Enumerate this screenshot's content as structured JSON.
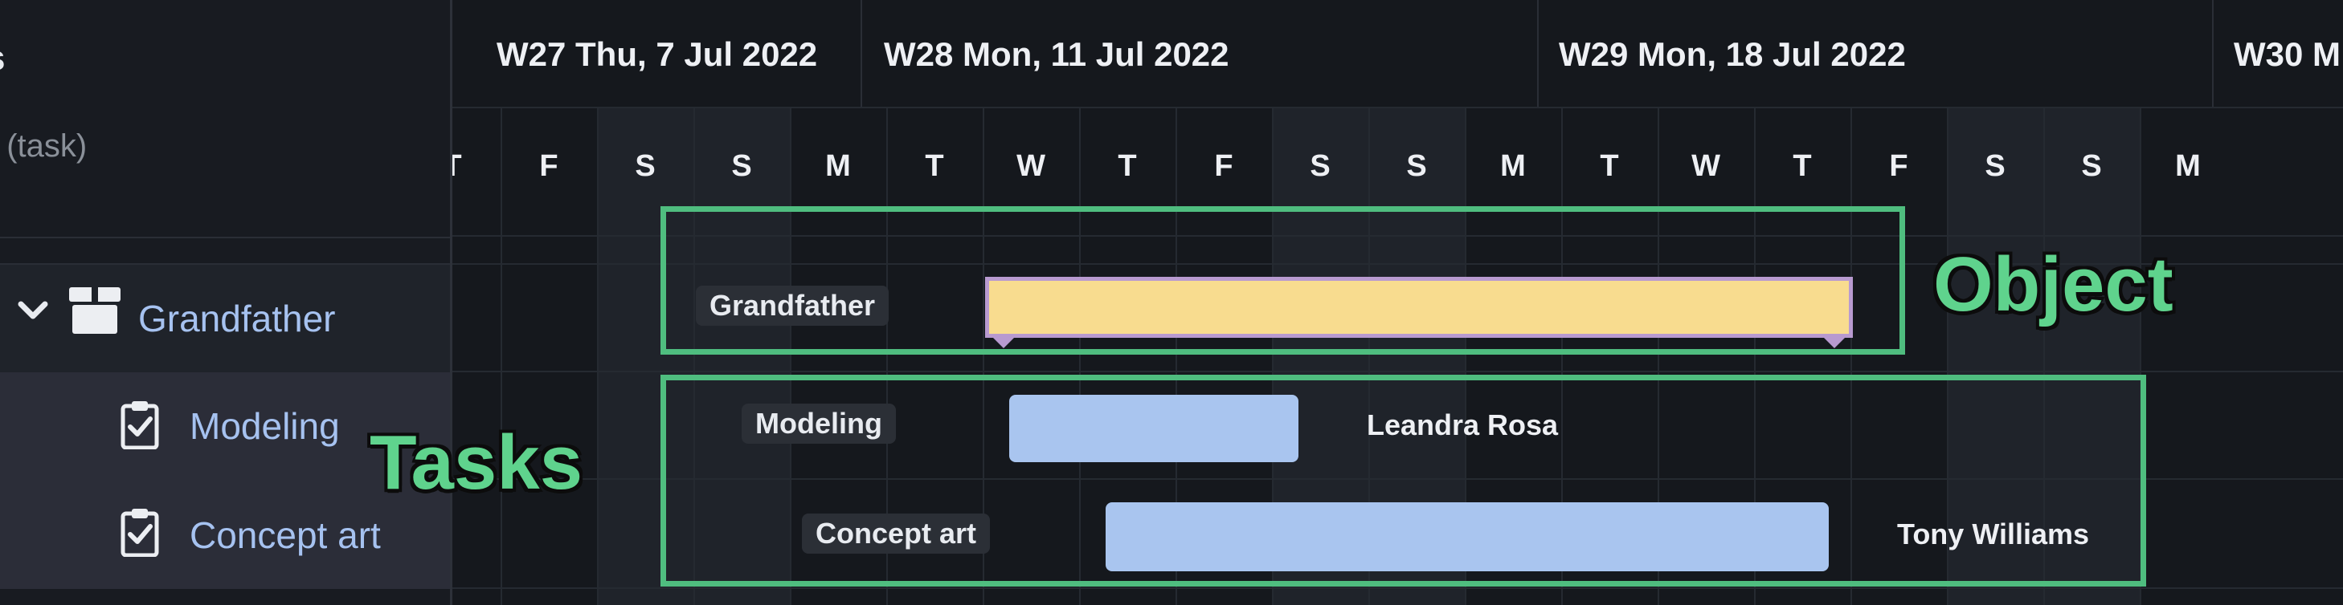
{
  "left_panel": {
    "header_title": "s",
    "header_subtitle": "t (task)",
    "rows": {
      "grandfather": {
        "label": "Grandfather",
        "icon": "box-icon",
        "expand_icon": "chevron-down-icon"
      },
      "modeling": {
        "label": "Modeling",
        "icon": "clipboard-check-icon"
      },
      "concept_art": {
        "label": "Concept art",
        "icon": "clipboard-check-icon"
      }
    }
  },
  "timeline": {
    "weeks": [
      {
        "label": "W27 Thu, 7 Jul 2022"
      },
      {
        "label": "W28 Mon, 11 Jul 2022"
      },
      {
        "label": "W29 Mon, 18 Jul 2022"
      },
      {
        "label": "W30 M"
      }
    ],
    "days": [
      {
        "letter": "T",
        "weekend": false
      },
      {
        "letter": "F",
        "weekend": false
      },
      {
        "letter": "S",
        "weekend": true
      },
      {
        "letter": "S",
        "weekend": true
      },
      {
        "letter": "M",
        "weekend": false
      },
      {
        "letter": "T",
        "weekend": false
      },
      {
        "letter": "W",
        "weekend": false
      },
      {
        "letter": "T",
        "weekend": false
      },
      {
        "letter": "F",
        "weekend": false
      },
      {
        "letter": "S",
        "weekend": true
      },
      {
        "letter": "S",
        "weekend": true
      },
      {
        "letter": "M",
        "weekend": false
      },
      {
        "letter": "T",
        "weekend": false
      },
      {
        "letter": "W",
        "weekend": false
      },
      {
        "letter": "T",
        "weekend": false
      },
      {
        "letter": "F",
        "weekend": false
      },
      {
        "letter": "S",
        "weekend": true
      },
      {
        "letter": "S",
        "weekend": true
      },
      {
        "letter": "M",
        "weekend": false
      }
    ]
  },
  "bars": {
    "grandfather": {
      "label": "Grandfather",
      "color": "#f8dc8f",
      "border_color": "#b89ad0"
    },
    "modeling": {
      "label": "Modeling",
      "assignee": "Leandra Rosa",
      "color": "#a9c5ef"
    },
    "concept_art": {
      "label": "Concept art",
      "assignee": "Tony Williams",
      "color": "#a9c5ef"
    }
  },
  "annotations": {
    "object_label": "Object",
    "tasks_label": "Tasks",
    "color": "#4fbd7f"
  }
}
